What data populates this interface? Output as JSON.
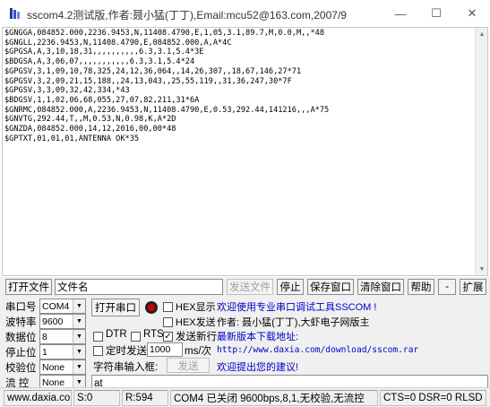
{
  "window": {
    "title": "sscom4.2测试版,作者:聂小猛(丁丁),Email:mcu52@163.com,2007/9",
    "minimize_glyph": "—",
    "maximize_glyph": "☐",
    "close_glyph": "✕"
  },
  "receive": {
    "lines": [
      "$GNGGA,084852.000,2236.9453,N,11408.4790,E,1,05,3.1,89.7,M,0.0,M,,*48",
      "$GNGLL,2236.9453,N,11408.4790,E,084852.000,A,A*4C",
      "$GPGSA,A,3,10,18,31,,,,,,,,,,6.3,3.1,5.4*3E",
      "$BDGSA,A,3,06,07,,,,,,,,,,,6.3,3.1,5.4*24",
      "$GPGSV,3,1,09,10,78,325,24,12,36,064,,14,26,307,,18,67,146,27*71",
      "$GPGSV,3,2,09,21,15,188,,24,13,043,,25,55,119,,31,36,247,30*7F",
      "$GPGSV,3,3,09,32,42,334,*43",
      "$BDGSV,1,1,02,06,68,055,27,07,82,211,31*6A",
      "$GNRMC,084852.000,A,2236.9453,N,11408.4790,E,0.53,292.44,141216,,,A*75",
      "$GNVTG,292.44,T,,M,0.53,N,0.98,K,A*2D",
      "$GNZDA,084852.000,14,12,2016,00,00*48",
      "$GPTXT,01,01,01,ANTENNA OK*35"
    ]
  },
  "toolbar": {
    "open_file": "打开文件",
    "file_name": "文件名",
    "send_file": "发送文件",
    "stop": "停止",
    "save_window": "保存窗口",
    "clear_window": "清除窗口",
    "help": "帮助",
    "collapse": "-",
    "expand": "扩展"
  },
  "port": {
    "port_label": "串口号",
    "port_value": "COM4",
    "baud_label": "波特率",
    "baud_value": "9600",
    "data_label": "数据位",
    "data_value": "8",
    "stop_label": "停止位",
    "stop_value": "1",
    "parity_label": "校验位",
    "parity_value": "None",
    "flow_label": "流 控",
    "flow_value": "None",
    "open_button": "打开串口"
  },
  "options": {
    "hex_display": "HEX显示",
    "hex_send": "HEX发送",
    "dtr": "DTR",
    "rts": "RTS",
    "send_newline": "发送新行",
    "timed_send": "定时发送",
    "interval": "1000",
    "interval_unit": "ms/次",
    "string_input": "字符串输入框:",
    "send": "发送",
    "send_text": "at"
  },
  "info": {
    "welcome": "欢迎使用专业串口调试工具SSCOM !",
    "author": "作者: 聂小猛(丁丁),大虾电子网版主",
    "download": "最新版本下载地址:",
    "url": "http://www.daxia.com/download/sscom.rar",
    "feedback": "欢迎提出您的建议!"
  },
  "status": {
    "site": "www.daxia.com",
    "sent": "S:0",
    "received": "R:594",
    "port_state": "COM4 已关闭  9600bps,8,1,无校验,无流控",
    "lines": "CTS=0 DSR=0 RLSD"
  },
  "colors": {
    "info_blue": "#0000c8",
    "led_red": "#d00000",
    "disabled_gray": "#a0a0a0"
  }
}
